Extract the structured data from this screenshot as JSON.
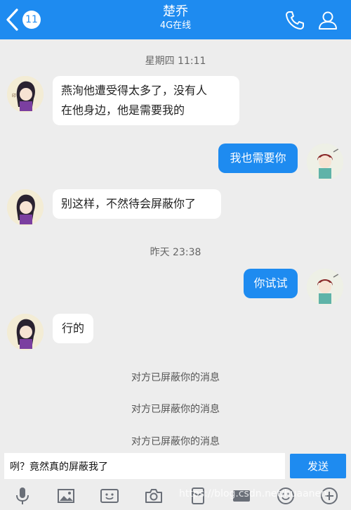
{
  "header": {
    "title": "楚乔",
    "subtitle": "4G在线",
    "unread_badge": "11",
    "accent_color": "#1e8bf0"
  },
  "chat": {
    "timestamps": [
      "星期四 11:11",
      "昨天 23:38"
    ],
    "messages": [
      {
        "side": "incoming",
        "lines": [
          "燕洵他遭受得太多了，没有人",
          "在他身边，他是需要我的"
        ]
      },
      {
        "side": "outgoing",
        "text": "我也需要你"
      },
      {
        "side": "incoming",
        "text": "别这样，不然待会屏蔽你了"
      },
      {
        "side": "outgoing",
        "text": "你试试"
      },
      {
        "side": "incoming",
        "text": "行的"
      }
    ],
    "system_notices": [
      "对方已屏蔽你的消息",
      "对方已屏蔽你的消息",
      "对方已屏蔽你的消息"
    ]
  },
  "composer": {
    "input_value": "咧？竟然真的屏蔽我了",
    "send_label": "发送"
  },
  "toolbar_icons": [
    "mic-icon",
    "image-icon",
    "video-icon",
    "camera-icon",
    "red-packet-icon",
    "gif-icon",
    "emoji-icon",
    "plus-icon"
  ],
  "watermark": "https://blog.csdn.net/huaanen"
}
